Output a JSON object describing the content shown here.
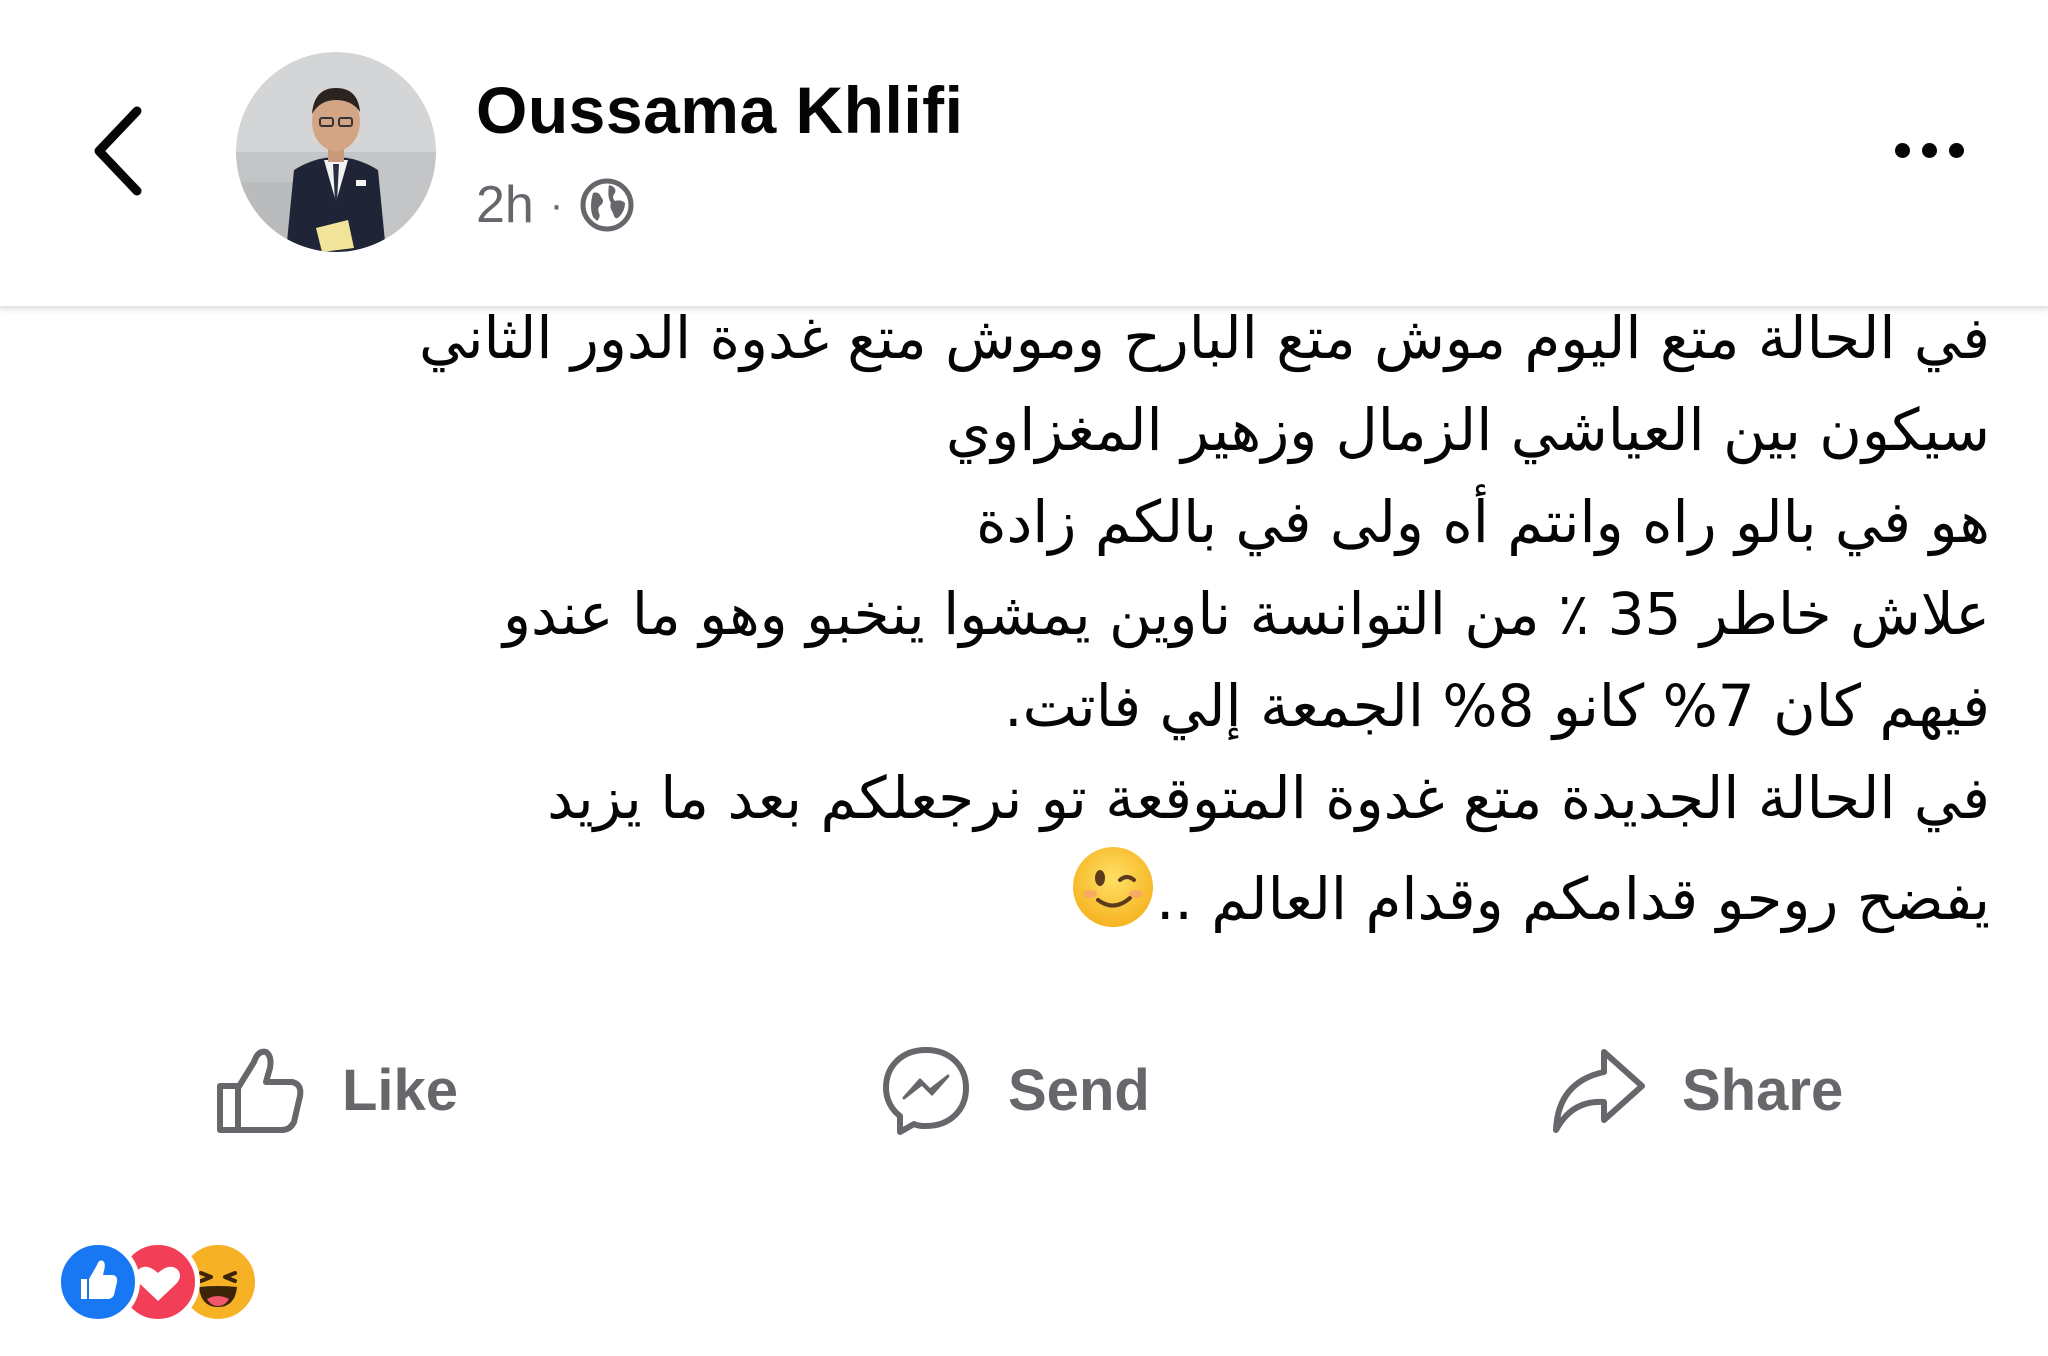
{
  "header": {
    "back_icon": "chevron-left-icon",
    "author_name": "Oussama Khlifi",
    "time": "2h",
    "separator": "·",
    "audience_icon": "globe-icon",
    "more_icon": "more-dots-icon"
  },
  "post": {
    "lines": [
      "في الحالة متع اليوم موش متع البارح وموش متع غدوة  الدور الثاني",
      "سيكون بين العياشي الزمال وزهير المغزاوي",
      "هو في بالو راه وانتم أه ولى في بالكم زادة",
      "علاش خاطر 35 ٪  من التوانسة ناوين يمشوا ينخبو وهو ما عندو",
      "فيهم كان 7%  كانو 8% الجمعة إلي فاتت.",
      "في الحالة الجديدة متع غدوة المتوقعة تو نرجعلكم بعد ما يزيد",
      "يفضح روحو قدامكم وقدام العالم  .."
    ],
    "trailing_emoji": "winking-face-emoji"
  },
  "actions": {
    "like_label": "Like",
    "send_label": "Send",
    "share_label": "Share"
  },
  "reactions": [
    "like",
    "love",
    "haha"
  ],
  "colors": {
    "text": "#050505",
    "secondary": "#65676b",
    "like_blue": "#1877f2",
    "love_red": "#f33e58",
    "haha_yellow": "#f7b125",
    "divider": "#e4e6eb"
  }
}
